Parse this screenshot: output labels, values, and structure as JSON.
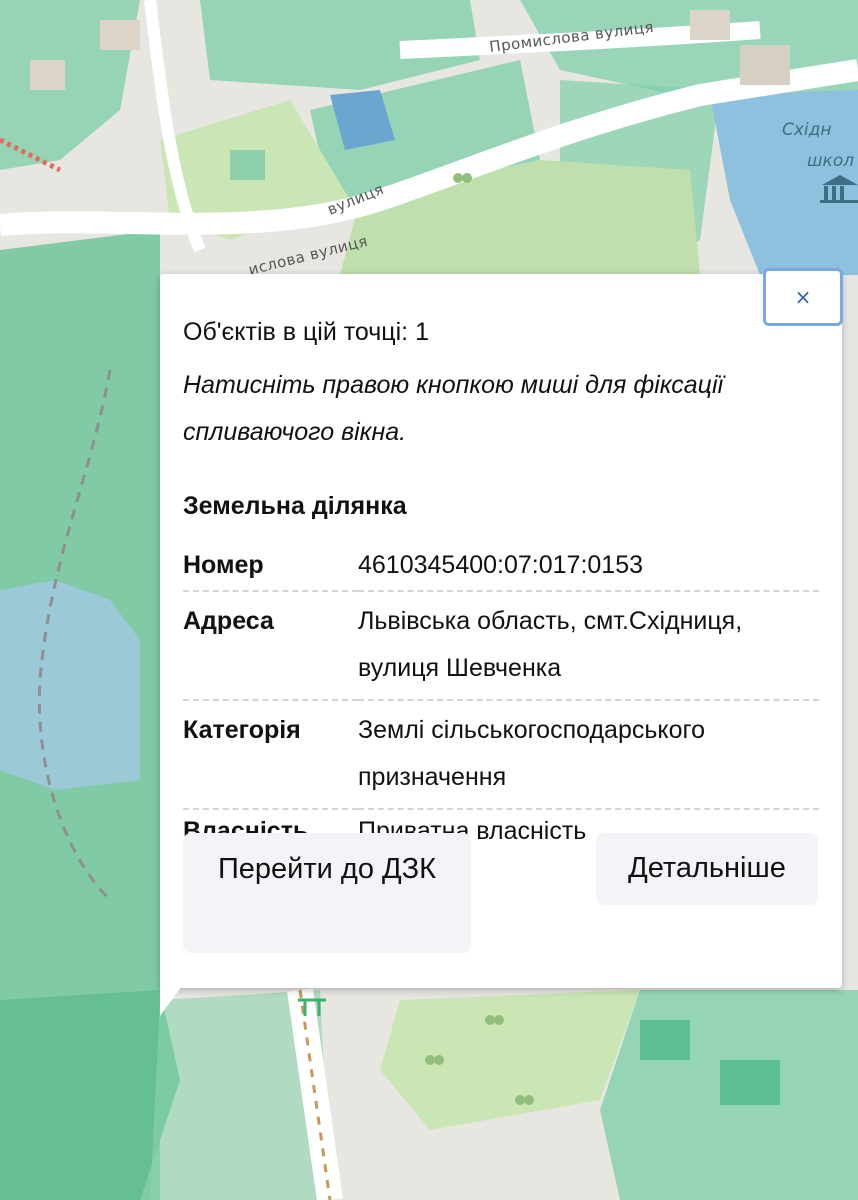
{
  "map": {
    "streets": {
      "promyslova_top": "Промислова вулиця",
      "promyslova_left_a": "вулиця",
      "promyslova_left_b": "ислова вулиця"
    },
    "school_label_1": "Східн",
    "school_label_2": "школ",
    "colors": {
      "base": "#e8e6e1",
      "parcel_green": "#7fcfa9",
      "parcel_green_dark": "#5dbf95",
      "park": "#c9e6b4",
      "water": "#9cc9d8",
      "school_blue": "#8ec1dd",
      "road": "#ffffff"
    }
  },
  "popup": {
    "objects_count": "Об'єктів в цій точці: 1",
    "hint": "Натисніть правою кнопкою миші для фіксації спливаючого вікна.",
    "section_title": "Земельна ділянка",
    "close_label": "×",
    "rows": [
      {
        "key": "Номер",
        "value": "4610345400:07:017:0153"
      },
      {
        "key": "Адреса",
        "value": "Львівська область, смт.Східниця, вулиця Шевченка"
      },
      {
        "key": "Категорія",
        "value": "Землі сільськогосподарського призначення"
      },
      {
        "key": "Власність",
        "value": "Приватна власність"
      }
    ],
    "buttons": {
      "dzk": "Перейти до ДЗК",
      "details": "Детальніше"
    }
  }
}
